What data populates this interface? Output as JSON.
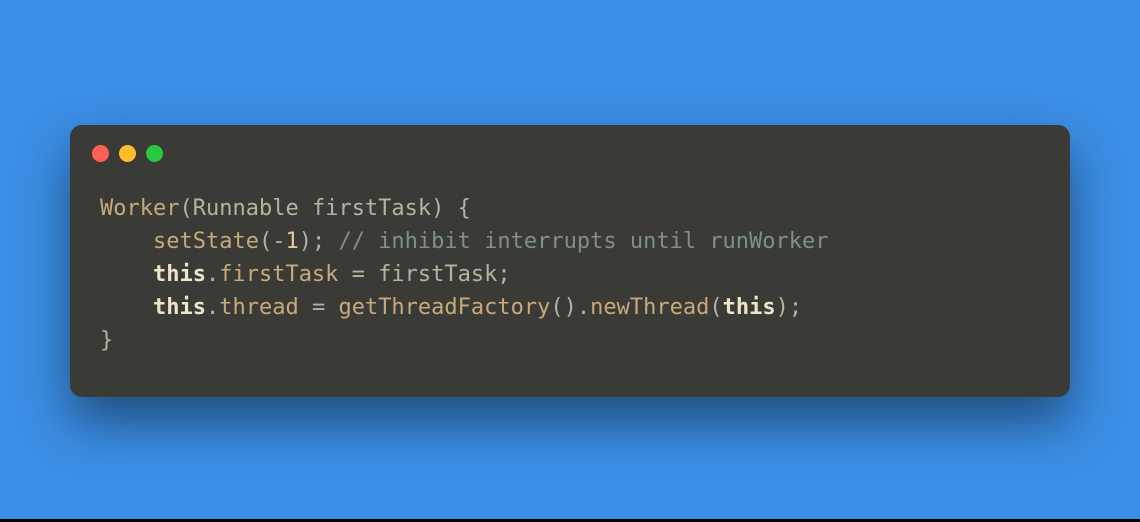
{
  "colors": {
    "background": "#3b8ee5",
    "window": "#3a3a37",
    "traffic_red": "#ff5f56",
    "traffic_yellow": "#ffbd2e",
    "traffic_green": "#27c93f"
  },
  "code": {
    "line1": {
      "ctor": "Worker",
      "lparen": "(",
      "param_type": "Runnable",
      "space1": " ",
      "param_name": "firstTask",
      "rparen_brace": ") {"
    },
    "line2": {
      "indent": "    ",
      "call": "setState",
      "args": "(-",
      "num": "1",
      "close": ");",
      "space": " ",
      "comment": "// inhibit interrupts until runWorker"
    },
    "line3": {
      "indent": "    ",
      "kw": "this",
      "dot": ".",
      "field": "firstTask",
      "eq": " = ",
      "rhs": "firstTask",
      "semi": ";"
    },
    "line4": {
      "indent": "    ",
      "kw": "this",
      "dot": ".",
      "field": "thread",
      "eq": " = ",
      "call1": "getThreadFactory",
      "p1": "().",
      "call2": "newThread",
      "p2": "(",
      "kw2": "this",
      "p3": ");"
    },
    "line5": {
      "brace": "}"
    }
  }
}
